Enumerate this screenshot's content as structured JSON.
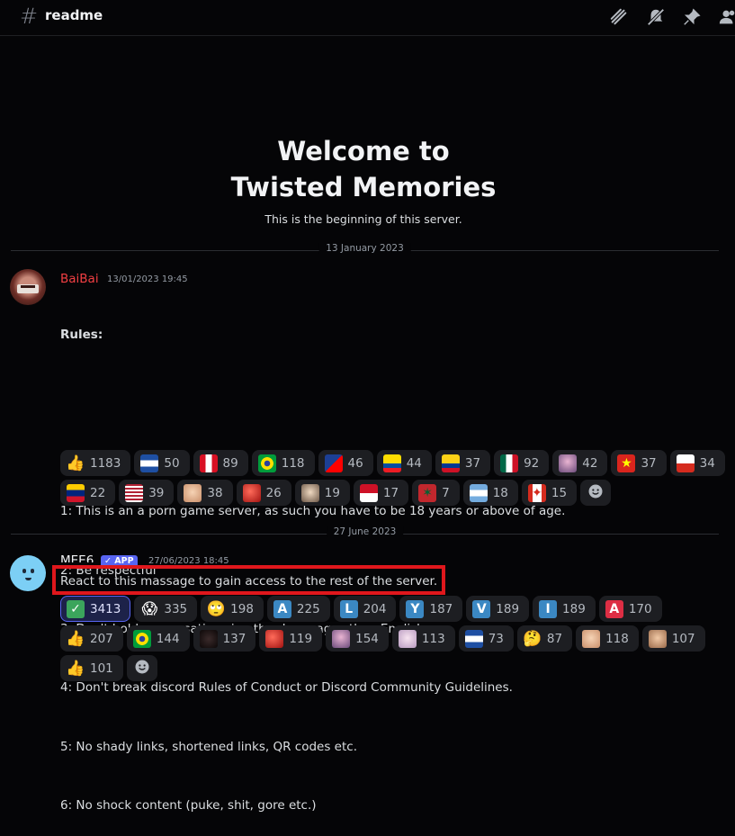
{
  "header": {
    "channel_name": "readme",
    "icons": [
      "threads-icon",
      "mute-bell-icon",
      "pin-icon",
      "members-icon"
    ]
  },
  "welcome": {
    "title_line1": "Welcome to",
    "title_line2": "Twisted Memories",
    "subtitle": "This is the beginning of this server."
  },
  "dividers": [
    "13 January 2023",
    "27 June 2023"
  ],
  "messages": [
    {
      "author": "BaiBai",
      "author_color": "#f23f43",
      "timestamp": "13/01/2023 19:45",
      "lines": [
        "Rules:",
        "",
        "1: This is an a porn game server, as such you have to be 18 years or above of age.",
        "2: Be respectful",
        "3: Don't hold conversations in other languages than English.",
        "4: Don't break discord Rules of Conduct or Discord Community Guidelines.",
        "5: No shady links, shortened links, QR codes etc.",
        "6: No shock content (puke, shit, gore etc.)"
      ],
      "reactions": [
        {
          "emoji": "thumbs-up-emoji",
          "count": "1183"
        },
        {
          "emoji": "flag-honduras-emoji",
          "count": "50"
        },
        {
          "emoji": "flag-peru-emoji",
          "count": "89"
        },
        {
          "emoji": "flag-brazil-emoji",
          "count": "118"
        },
        {
          "emoji": "flag-taiwan-emoji",
          "count": "46"
        },
        {
          "emoji": "flag-ecuador-emoji",
          "count": "44"
        },
        {
          "emoji": "flag-colombia-emoji",
          "count": "37"
        },
        {
          "emoji": "flag-mexico-emoji",
          "count": "92"
        },
        {
          "emoji": "custom-anime-emoji",
          "count": "42"
        },
        {
          "emoji": "flag-vietnam-emoji",
          "count": "37"
        },
        {
          "emoji": "flag-chile-emoji",
          "count": "34"
        },
        {
          "emoji": "flag-venezuela-emoji",
          "count": "22"
        },
        {
          "emoji": "flag-usa-emoji",
          "count": "39"
        },
        {
          "emoji": "custom-face-emoji",
          "count": "38"
        },
        {
          "emoji": "custom-red-emoji",
          "count": "26"
        },
        {
          "emoji": "custom-pale-face-emoji",
          "count": "19"
        },
        {
          "emoji": "flag-indonesia-emoji",
          "count": "17"
        },
        {
          "emoji": "flag-morocco-emoji",
          "count": "7"
        },
        {
          "emoji": "flag-argentina-emoji",
          "count": "18"
        },
        {
          "emoji": "flag-canada-emoji",
          "count": "15"
        }
      ]
    },
    {
      "author": "MEE6",
      "author_color": "#f2f3f5",
      "badge": "APP",
      "timestamp": "27/06/2023 18:45",
      "text": "React to this massage to gain access to the rest of the server.",
      "reactions": [
        {
          "emoji": "check-mark-emoji",
          "count": "3413",
          "active": true
        },
        {
          "emoji": "scream-emoji",
          "count": "335"
        },
        {
          "emoji": "eye-roll-emoji",
          "count": "198"
        },
        {
          "emoji": "letter-a-emoji",
          "count": "225"
        },
        {
          "emoji": "letter-l-emoji",
          "count": "204"
        },
        {
          "emoji": "letter-y-emoji",
          "count": "187"
        },
        {
          "emoji": "letter-v-emoji",
          "count": "189"
        },
        {
          "emoji": "letter-i-emoji",
          "count": "189"
        },
        {
          "emoji": "letter-a-red-emoji",
          "count": "170"
        },
        {
          "emoji": "thumbs-up-emoji",
          "count": "207"
        },
        {
          "emoji": "flag-brazil-emoji",
          "count": "144"
        },
        {
          "emoji": "custom-dark-emoji",
          "count": "137"
        },
        {
          "emoji": "custom-red-emoji",
          "count": "119"
        },
        {
          "emoji": "custom-anime-emoji",
          "count": "154"
        },
        {
          "emoji": "custom-pink-emoji",
          "count": "113"
        },
        {
          "emoji": "flag-honduras-emoji",
          "count": "73"
        },
        {
          "emoji": "thinking-emoji",
          "count": "87"
        },
        {
          "emoji": "custom-face-emoji",
          "count": "118"
        },
        {
          "emoji": "custom-face2-emoji",
          "count": "107"
        },
        {
          "emoji": "thumbs-up-light-emoji",
          "count": "101"
        }
      ]
    }
  ]
}
